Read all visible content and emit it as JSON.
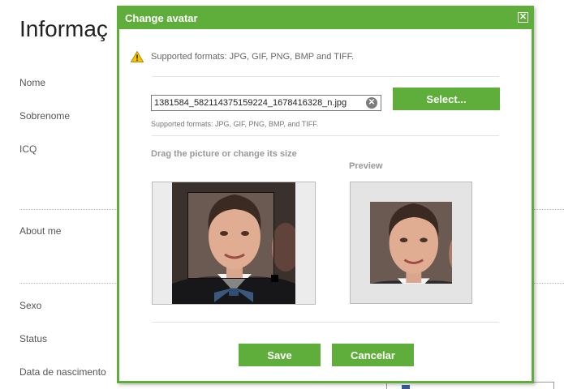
{
  "background": {
    "page_title": "Informaç",
    "labels": {
      "first_name": "Nome",
      "last_name": "Sobrenome",
      "icq": "ICQ",
      "about": "About me",
      "gender": "Sexo",
      "status": "Status",
      "birthdate": "Data de nascimento"
    }
  },
  "dialog": {
    "title": "Change avatar",
    "close_icon": "close-icon",
    "warning_icon": "warning-icon",
    "warning_text": "Supported formats: JPG, GIF, PNG, BMP and TIFF.",
    "file_input_value": "1381584_582114375159224_1678416328_n.jpg",
    "clear_icon": "clear-icon",
    "select_label": "Select...",
    "hint_text": "Supported formats: JPG, GIF, PNG, BMP, and TIFF.",
    "crop_label": "Drag the picture or change its size",
    "preview_label": "Preview",
    "save_label": "Save",
    "cancel_label": "Cancelar"
  },
  "colors": {
    "accent": "#5fad3a",
    "background": "#ffffff"
  }
}
